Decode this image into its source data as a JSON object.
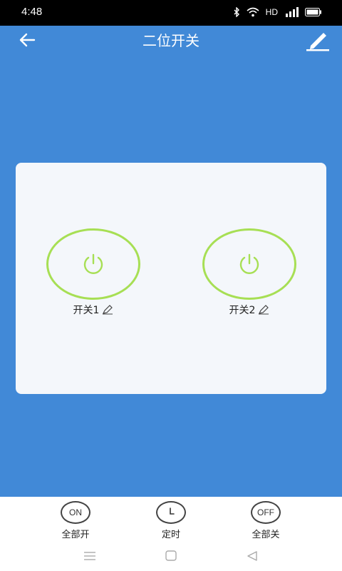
{
  "status_bar": {
    "time": "4:48",
    "hd": "HD",
    "icons": [
      "bluetooth-icon",
      "wifi-icon",
      "signal-icon",
      "battery-icon"
    ]
  },
  "header": {
    "title": "二位开关",
    "back_icon": "arrow-left-icon",
    "edit_icon": "pencil-icon"
  },
  "switches": [
    {
      "label": "开关1",
      "icon": "power-icon",
      "edit_icon": "pencil-icon"
    },
    {
      "label": "开关2",
      "icon": "power-icon",
      "edit_icon": "pencil-icon"
    }
  ],
  "actions": [
    {
      "label": "全部开",
      "icon_text": "ON"
    },
    {
      "label": "定时",
      "icon": "clock-icon"
    },
    {
      "label": "全部关",
      "icon_text": "OFF"
    }
  ],
  "nav_bar": {
    "icons": [
      "menu-icon",
      "home-icon",
      "back-triangle-icon"
    ]
  },
  "colors": {
    "primary": "#4189d7",
    "card": "#f4f7fb",
    "switch_ring": "#a7df54",
    "status_bar": "#000000"
  }
}
